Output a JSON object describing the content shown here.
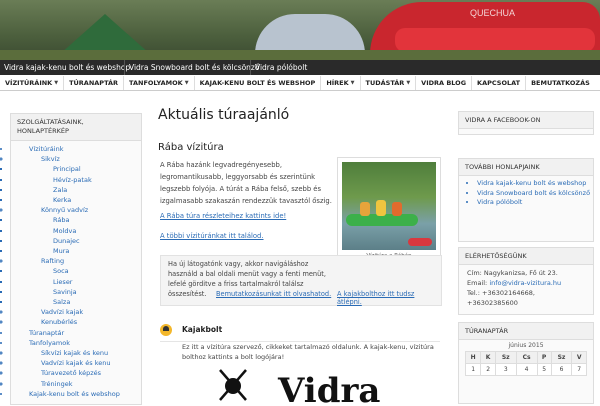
{
  "header": {
    "brand": "QUECHUA"
  },
  "site_links": [
    "Vidra kajak-kenu bolt és webshop",
    "Vidra Snowboard bolt és kölcsönző",
    "Vidra pólóbolt"
  ],
  "nav": [
    {
      "label": "VÍZITÚRÁINK",
      "caret": true
    },
    {
      "label": "TÚRANAPTÁR",
      "caret": false
    },
    {
      "label": "TANFOLYAMOK",
      "caret": true
    },
    {
      "label": "KAJAK-KENU BOLT ÉS WEBSHOP",
      "caret": false
    },
    {
      "label": "HÍREK",
      "caret": true
    },
    {
      "label": "TUDÁSTÁR",
      "caret": true
    },
    {
      "label": "VIDRA BLOG",
      "caret": false
    },
    {
      "label": "KAPCSOLAT",
      "caret": false
    },
    {
      "label": "BEMUTATKOZÁS",
      "caret": false
    }
  ],
  "left": {
    "heading": "SZOLGÁLTATÁSAINK, HONLAPTÉRKÉP",
    "items": [
      {
        "label": "Vízitúráink",
        "level": 1
      },
      {
        "label": "Sikvíz",
        "level": 2
      },
      {
        "label": "Principal",
        "level": 3
      },
      {
        "label": "Hévíz-patak",
        "level": 3
      },
      {
        "label": "Zala",
        "level": 3
      },
      {
        "label": "Kerka",
        "level": 3
      },
      {
        "label": "Könnyű vadvíz",
        "level": 2
      },
      {
        "label": "Rába",
        "level": 3
      },
      {
        "label": "Moldva",
        "level": 3
      },
      {
        "label": "Dunajec",
        "level": 3
      },
      {
        "label": "Mura",
        "level": 3
      },
      {
        "label": "Rafting",
        "level": 2
      },
      {
        "label": "Soca",
        "level": 3
      },
      {
        "label": "Lieser",
        "level": 3
      },
      {
        "label": "Savinja",
        "level": 3
      },
      {
        "label": "Salza",
        "level": 3
      },
      {
        "label": "Vadvízi kajak",
        "level": 2
      },
      {
        "label": "Kenubérlés",
        "level": 2
      },
      {
        "label": "Túranaptár",
        "level": 1
      },
      {
        "label": "Tanfolyamok",
        "level": 1
      },
      {
        "label": "Síkvízi kajak és kenu",
        "level": 2
      },
      {
        "label": "Vadvízi kajak és kenu",
        "level": 2
      },
      {
        "label": "Túravezető képzés",
        "level": 2
      },
      {
        "label": "Tréningek",
        "level": 2
      },
      {
        "label": "Kajak-kenu bolt és webshop",
        "level": 1
      }
    ]
  },
  "main": {
    "title": "Aktuális túraajánló",
    "subtitle": "Rába vízitúra",
    "intro_lines": [
      "A Rába hazánk legvadregényesebb,",
      "legromantikusabb, leggyorsabb és szerintünk",
      "legszebb folyója. A túrát a Rába felső, szebb és",
      "izgalmasabb szakaszán rendezzük tavasztól őszig."
    ],
    "link_details": "A Rába túra részleteihez kattints ide!",
    "link_others": "A többi vízitúránkat itt találod.",
    "photo_caption": "Vízitúra a Rábán",
    "notice_lines": [
      "Ha új látogatónk vagy, akkor navigáláshoz",
      "használd a bal oldali menüt vagy a fenti menüt,",
      "lefelé görditve a friss tartalmakról találsz",
      "összesítést."
    ],
    "notice_link1": "Bemutatkozásunkat itt olvashatod.",
    "notice_link2": "A kajakbolthoz itt tudsz átlépni.",
    "kajakbolt_title": "Kajakbolt",
    "kajakbolt_lines": [
      "Ez itt a vízitúra szervező, cikkeket tartalmazó oldalunk. A kajak-kenu, vízitúra",
      "bolthoz kattints a bolt logójára!"
    ],
    "logo_text": "Vidra"
  },
  "right": {
    "facebook_heading": "VIDRA A FACEBOOK-ON",
    "more_sites_heading": "TOVÁBBI HONLAPJAINK",
    "more_sites": [
      "Vidra kajak-kenu bolt és webshop",
      "Vidra Snowboard bolt és kölcsönző",
      "Vidra pólóbolt"
    ],
    "contact_heading": "ELÉRHETŐSÉGÜNK",
    "contact_address": "Cím: Nagykanizsa, Fő út 23.",
    "contact_email_label": "Email:",
    "contact_email": "info@vidra-vizitura.hu",
    "contact_phone": "Tel.: +36302164668, +36302385600",
    "calendar_heading": "TÚRANAPTÁR",
    "calendar_month": "június 2015",
    "calendar_days": [
      "H",
      "K",
      "Sz",
      "Cs",
      "P",
      "Sz",
      "V"
    ],
    "calendar_week1": [
      "1",
      "2",
      "3",
      "4",
      "5",
      "6",
      "7"
    ]
  }
}
